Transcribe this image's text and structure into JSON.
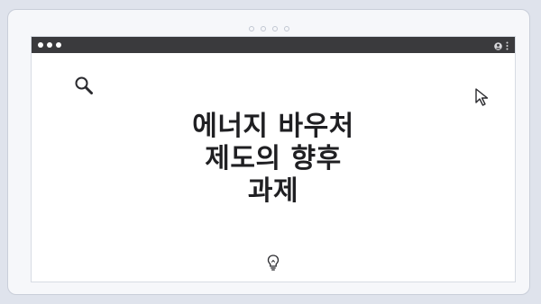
{
  "headline": {
    "lines": [
      "에너지 바우처",
      "제도의 향후",
      "과제"
    ]
  },
  "icons": {
    "search": "search-icon",
    "cursor": "cursor-arrow-icon",
    "bulb": "lightbulb-icon",
    "user": "user-icon",
    "menu": "kebab-menu-icon"
  },
  "colors": {
    "background": "#dfe3ec",
    "titlebar": "#3a3a3d",
    "text": "#1f1f22"
  }
}
